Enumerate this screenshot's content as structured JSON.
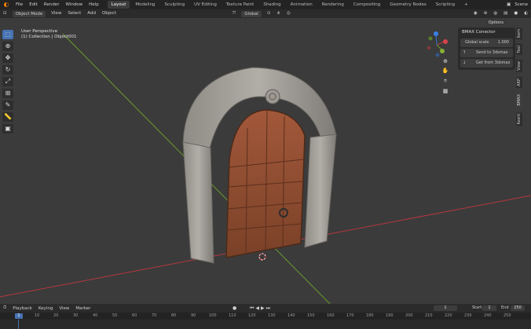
{
  "topbar": {
    "menus": [
      "File",
      "Edit",
      "Render",
      "Window",
      "Help"
    ],
    "workspaces": [
      "Layout",
      "Modeling",
      "Sculpting",
      "UV Editing",
      "Texture Paint",
      "Shading",
      "Animation",
      "Rendering",
      "Compositing",
      "Geometry Nodes",
      "Scripting"
    ],
    "active_workspace": "Layout",
    "scene_label": "Scene"
  },
  "header": {
    "mode": "Object Mode",
    "menus": [
      "View",
      "Select",
      "Add",
      "Object"
    ],
    "transform_orientation": "Global",
    "options_label": "Options"
  },
  "viewport": {
    "perspective_label": "User Perspective",
    "collection_label": "(1) Collection | Object001"
  },
  "npanel": {
    "title": "BMAX Conector",
    "scale_label": "Global scale",
    "scale_value": "1.000",
    "send_label": "Send to 3dsmax",
    "get_label": "Get from 3dsmax",
    "tabs": [
      "Item",
      "Tool",
      "View",
      "ARP",
      "BMAX",
      "Kesitl"
    ]
  },
  "timeline": {
    "menus": [
      "Playback",
      "Keying",
      "View",
      "Marker"
    ],
    "current_frame": "1",
    "start_label": "Start",
    "start_value": "1",
    "end_label": "End",
    "end_value": "250",
    "ticks": [
      "1",
      "10",
      "20",
      "30",
      "40",
      "50",
      "60",
      "70",
      "80",
      "90",
      "100",
      "110",
      "120",
      "130",
      "140",
      "150",
      "160",
      "170",
      "180",
      "190",
      "200",
      "210",
      "220",
      "230",
      "240",
      "250"
    ]
  },
  "colors": {
    "accent": "#4772b3",
    "x_axis": "#b5383e",
    "y_axis": "#6f9a2c",
    "blender_orange": "#e87d0d"
  }
}
